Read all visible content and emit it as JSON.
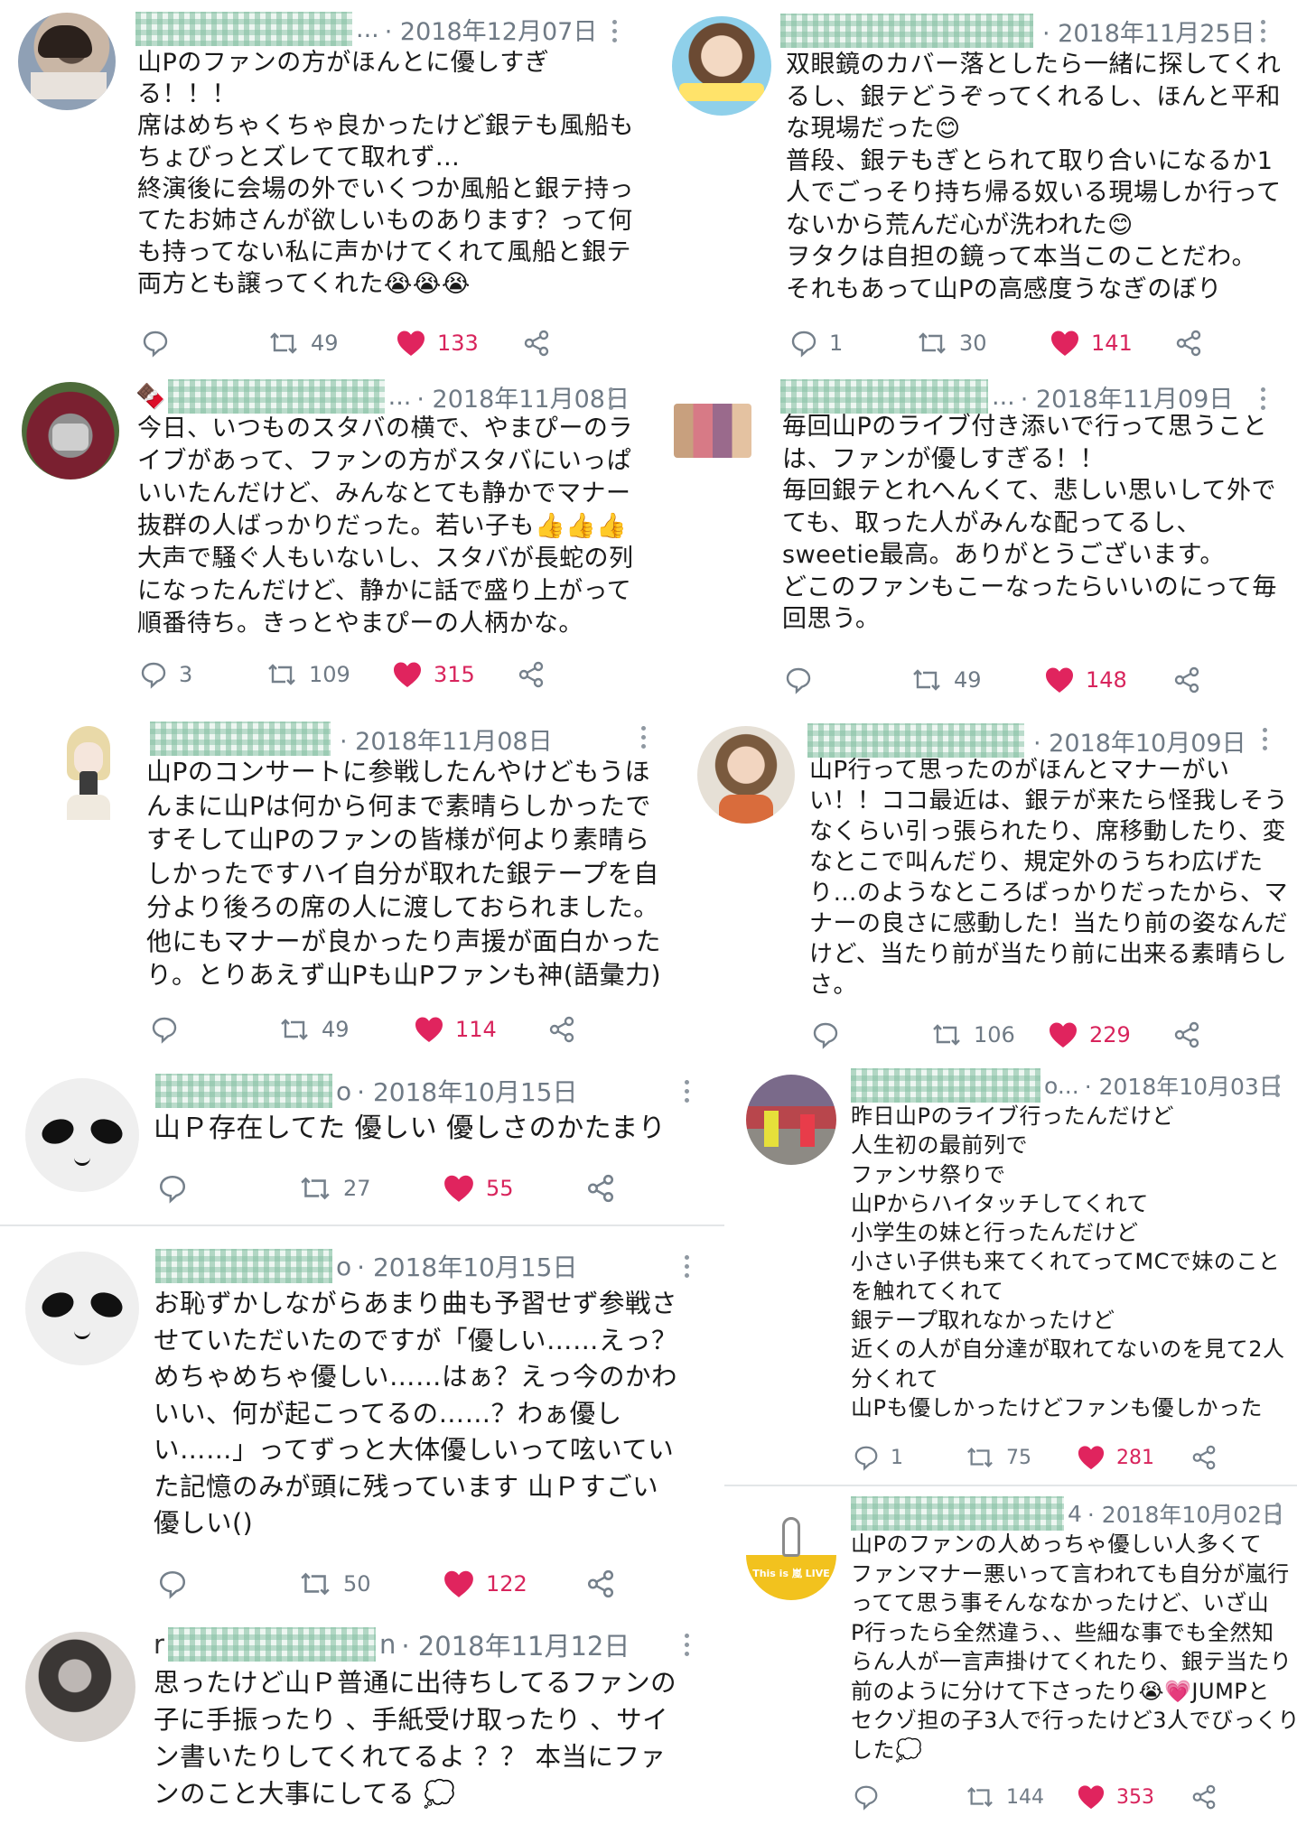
{
  "tweets": [
    {
      "name_suffix": "...",
      "date": "· 2018年12月07日",
      "text": "山Pのファンの方がほんとに優しすぎ\nる！！！\n席はめちゃくちゃ良かったけど銀テも風船も\nちょびっとズレてて取れず...\n終演後に会場の外でいくつか風船と銀テ持っ\nてたお姉さんが欲しいものあります？って何\nも持ってない私に声かけてくれて風船と銀テ\n両方とも譲ってくれた😭😭😭",
      "replies": "",
      "retweets": "49",
      "likes": "133"
    },
    {
      "name_suffix": "",
      "date": "· 2018年11月25日",
      "text": "双眼鏡のカバー落としたら一緒に探してくれ\nるし、銀テどうぞってくれるし、ほんと平和\nな現場だった😊\n普段、銀テもぎとられて取り合いになるか1\n人でごっそり持ち帰る奴いる現場しか行って\nないから荒んだ心が洗われた😊\nヲタクは自担の鏡って本当このことだわ。\nそれもあって山Pの高感度うなぎのぼり",
      "replies": "1",
      "retweets": "30",
      "likes": "141"
    },
    {
      "name_prefix": "🍫",
      "name_suffix": "...",
      "date": "· 2018年11月08日",
      "text": "今日、いつものスタバの横で、やまぴーのラ\nイブがあって、ファンの方がスタバにいっぱ\nいいたんだけど、みんなとても静かでマナー\n抜群の人ばっかりだった。若い子も👍👍👍\n大声で騒ぐ人もいないし、スタバが長蛇の列\nになったんだけど、静かに話で盛り上がって\n順番待ち。きっとやまぴーの人柄かな。",
      "replies": "3",
      "retweets": "109",
      "likes": "315"
    },
    {
      "name_suffix": "...",
      "date": "· 2018年11月09日",
      "text": "毎回山Pのライブ付き添いで行って思うこと\nは、ファンが優しすぎる！！\n毎回銀テとれへんくて、悲しい思いして外で\nても、取った人がみんな配ってるし、\nsweetie最高。ありがとうございます。\nどこのファンもこーなったらいいのにって毎\n回思う。",
      "replies": "",
      "retweets": "49",
      "likes": "148"
    },
    {
      "name_suffix": "",
      "date": "· 2018年11月08日",
      "text": "山Pのコンサートに参戦したんやけどもうほ\nんまに山Pは何から何まで素晴らしかったで\nすそして山Pのファンの皆様が何より素晴ら\nしかったですハイ自分が取れた銀テープを自\n分より後ろの席の人に渡しておられました。\n他にもマナーが良かったり声援が面白かった\nり。とりあえず山Pも山Pファンも神(語彙力)",
      "replies": "",
      "retweets": "49",
      "likes": "114"
    },
    {
      "name_suffix": "",
      "date": "· 2018年10月09日",
      "text": "山P行って思ったのがほんとマナーがい\nい！！ココ最近は、銀テが来たら怪我しそう\nなくらい引っ張られたり、席移動したり、変\nなとこで叫んだり、規定外のうちわ広げた\nり…のようなところばっかりだったから、マ\nナーの良さに感動した！当たり前の姿なんだ\nけど、当たり前が当たり前に出来る素晴らし\nさ。",
      "replies": "",
      "retweets": "106",
      "likes": "229"
    },
    {
      "name_suffix": "o",
      "date": "· 2018年10月15日",
      "text": "山Ｐ存在してた 優しい 優しさのかたまり",
      "replies": "",
      "retweets": "27",
      "likes": "55"
    },
    {
      "name_suffix": "o...",
      "date": "· 2018年10月03日",
      "text": "昨日山Pのライブ行ったんだけど\n人生初の最前列で\nファンサ祭りで\n山Pからハイタッチしてくれて\n小学生の妹と行ったんだけど\n小さい子供も来てくれてってMCで妹のこと\nを触れてくれて\n銀テープ取れなかったけど\n近くの人が自分達が取れてないのを見て2人\n分くれて\n山Pも優しかったけどファンも優しかった",
      "replies": "1",
      "retweets": "75",
      "likes": "281"
    },
    {
      "name_suffix": "o",
      "date": "· 2018年10月15日",
      "text": "お恥ずかしながらあまり曲も予習せず参戦さ\nせていただいたのですが「優しい……えっ？\nめちゃめちゃ優しい……はぁ？えっ今のかわ\nいい、何が起こってるの……？わぁ優し\nい……」ってずっと大体優しいって呟いてい\nた記憶のみが頭に残っています 山Ｐすごい\n優しい()",
      "replies": "",
      "retweets": "50",
      "likes": "122"
    },
    {
      "name_suffix": "4",
      "date": "· 2018年10月02日",
      "text": "山Pのファンの人めっちゃ優しい人多くて\nファンマナー悪いって言われても自分が嵐行\nってて思う事そんななかったけど、いざ山\nP行ったら全然違う、、些細な事でも全然知\nらん人が一言声掛けてくれたり、銀テ当たり\n前のように分けて下さったり😭💗JUMPと\nセクゾ担の子3人で行ったけど3人でびっくり\nした💭",
      "replies": "",
      "retweets": "144",
      "likes": "353"
    },
    {
      "name_prefix": "r",
      "name_suffix": "n",
      "date": "· 2018年11月12日",
      "text": "思ったけど山Ｐ普通に出待ちしてるファンの\n子に手振ったり 、手紙受け取ったり 、サイ\nン書いたりしてくれてるよ ？？ 本当にファ\nンのこと大事にしてる 💭"
    }
  ],
  "avatar_badge_text": "This is 嵐 LIVE"
}
